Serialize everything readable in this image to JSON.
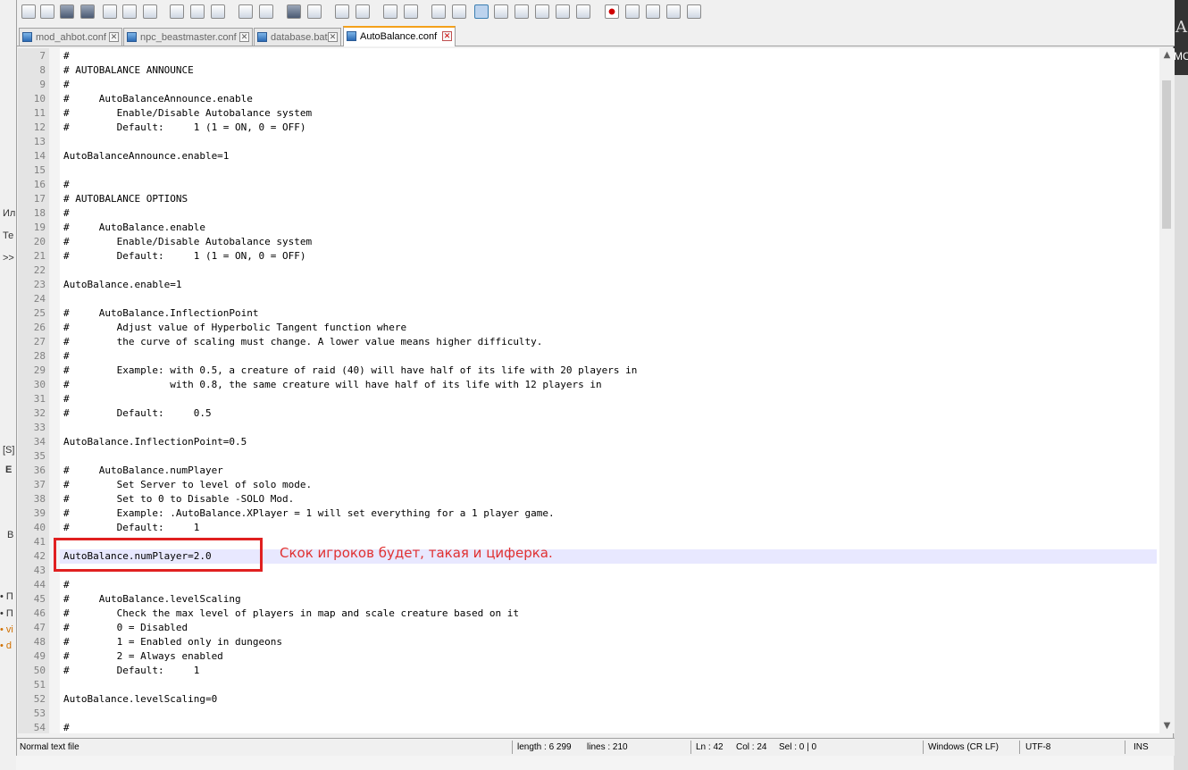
{
  "tabs": [
    {
      "label": "mod_ahbot.conf",
      "active": false
    },
    {
      "label": "npc_beastmaster.conf",
      "active": false
    },
    {
      "label": "database.bat",
      "active": false
    },
    {
      "label": "AutoBalance.conf",
      "active": true
    }
  ],
  "editor": {
    "lines": [
      {
        "n": "7",
        "text": "#"
      },
      {
        "n": "8",
        "text": "# AUTOBALANCE ANNOUNCE"
      },
      {
        "n": "9",
        "text": "#"
      },
      {
        "n": "10",
        "text": "#     AutoBalanceAnnounce.enable"
      },
      {
        "n": "11",
        "text": "#        Enable/Disable Autobalance system"
      },
      {
        "n": "12",
        "text": "#        Default:     1 (1 = ON, 0 = OFF)"
      },
      {
        "n": "13",
        "text": ""
      },
      {
        "n": "14",
        "text": "AutoBalanceAnnounce.enable=1"
      },
      {
        "n": "15",
        "text": ""
      },
      {
        "n": "16",
        "text": "#"
      },
      {
        "n": "17",
        "text": "# AUTOBALANCE OPTIONS"
      },
      {
        "n": "18",
        "text": "#"
      },
      {
        "n": "19",
        "text": "#     AutoBalance.enable"
      },
      {
        "n": "20",
        "text": "#        Enable/Disable Autobalance system"
      },
      {
        "n": "21",
        "text": "#        Default:     1 (1 = ON, 0 = OFF)"
      },
      {
        "n": "22",
        "text": ""
      },
      {
        "n": "23",
        "text": "AutoBalance.enable=1"
      },
      {
        "n": "24",
        "text": ""
      },
      {
        "n": "25",
        "text": "#     AutoBalance.InflectionPoint"
      },
      {
        "n": "26",
        "text": "#        Adjust value of Hyperbolic Tangent function where"
      },
      {
        "n": "27",
        "text": "#        the curve of scaling must change. A lower value means higher difficulty."
      },
      {
        "n": "28",
        "text": "#"
      },
      {
        "n": "29",
        "text": "#        Example: with 0.5, a creature of raid (40) will have half of its life with 20 players in"
      },
      {
        "n": "30",
        "text": "#                 with 0.8, the same creature will have half of its life with 12 players in"
      },
      {
        "n": "31",
        "text": "#"
      },
      {
        "n": "32",
        "text": "#        Default:     0.5"
      },
      {
        "n": "33",
        "text": ""
      },
      {
        "n": "34",
        "text": "AutoBalance.InflectionPoint=0.5"
      },
      {
        "n": "35",
        "text": ""
      },
      {
        "n": "36",
        "text": "#     AutoBalance.numPlayer"
      },
      {
        "n": "37",
        "text": "#        Set Server to level of solo mode."
      },
      {
        "n": "38",
        "text": "#        Set to 0 to Disable -SOLO Mod."
      },
      {
        "n": "39",
        "text": "#        Example: .AutoBalance.XPlayer = 1 will set everything for a 1 player game."
      },
      {
        "n": "40",
        "text": "#        Default:     1"
      },
      {
        "n": "41",
        "text": ""
      },
      {
        "n": "42",
        "text": "AutoBalance.numPlayer=2.0"
      },
      {
        "n": "43",
        "text": ""
      },
      {
        "n": "44",
        "text": "#"
      },
      {
        "n": "45",
        "text": "#     AutoBalance.levelScaling"
      },
      {
        "n": "46",
        "text": "#        Check the max level of players in map and scale creature based on it"
      },
      {
        "n": "47",
        "text": "#        0 = Disabled"
      },
      {
        "n": "48",
        "text": "#        1 = Enabled only in dungeons"
      },
      {
        "n": "49",
        "text": "#        2 = Always enabled"
      },
      {
        "n": "50",
        "text": "#        Default:     1"
      },
      {
        "n": "51",
        "text": ""
      },
      {
        "n": "52",
        "text": "AutoBalance.levelScaling=0"
      },
      {
        "n": "53",
        "text": ""
      },
      {
        "n": "54",
        "text": "#"
      }
    ],
    "current_line": "42"
  },
  "annotation": {
    "text": "Скок игроков будет, такая и циферка.",
    "color": "#e03030"
  },
  "statusbar": {
    "file_type": "Normal text file",
    "length": "length : 6 299",
    "lines": "lines : 210",
    "ln": "Ln : 42",
    "col": "Col : 24",
    "sel": "Sel : 0 | 0",
    "eol": "Windows (CR LF)",
    "encoding": "UTF-8",
    "mode": "INS"
  },
  "background_fragments": {
    "left": [
      "Ил",
      "Те",
      ">>",
      "[S]",
      "E",
      "В",
      "• П",
      "• П",
      "• vi",
      "• d"
    ],
    "right": [
      "A",
      "MC"
    ]
  },
  "toolbar_icons": [
    "new-file-icon",
    "open-file-icon",
    "save-icon",
    "save-all-icon",
    "close-icon",
    "close-all-icon",
    "print-icon",
    "cut-icon",
    "copy-icon",
    "paste-icon",
    "undo-icon",
    "redo-icon",
    "find-icon",
    "replace-icon",
    "zoom-in-icon",
    "zoom-out-icon",
    "sync-vertical-icon",
    "sync-horizontal-icon",
    "word-wrap-icon",
    "show-all-chars-icon",
    "indent-guide-icon",
    "doc-map-icon",
    "function-list-icon",
    "folder-workspace-icon",
    "monitoring-icon",
    "record-macro-icon",
    "stop-macro-icon",
    "play-macro-icon",
    "run-macro-multiple-icon",
    "save-macro-icon"
  ]
}
